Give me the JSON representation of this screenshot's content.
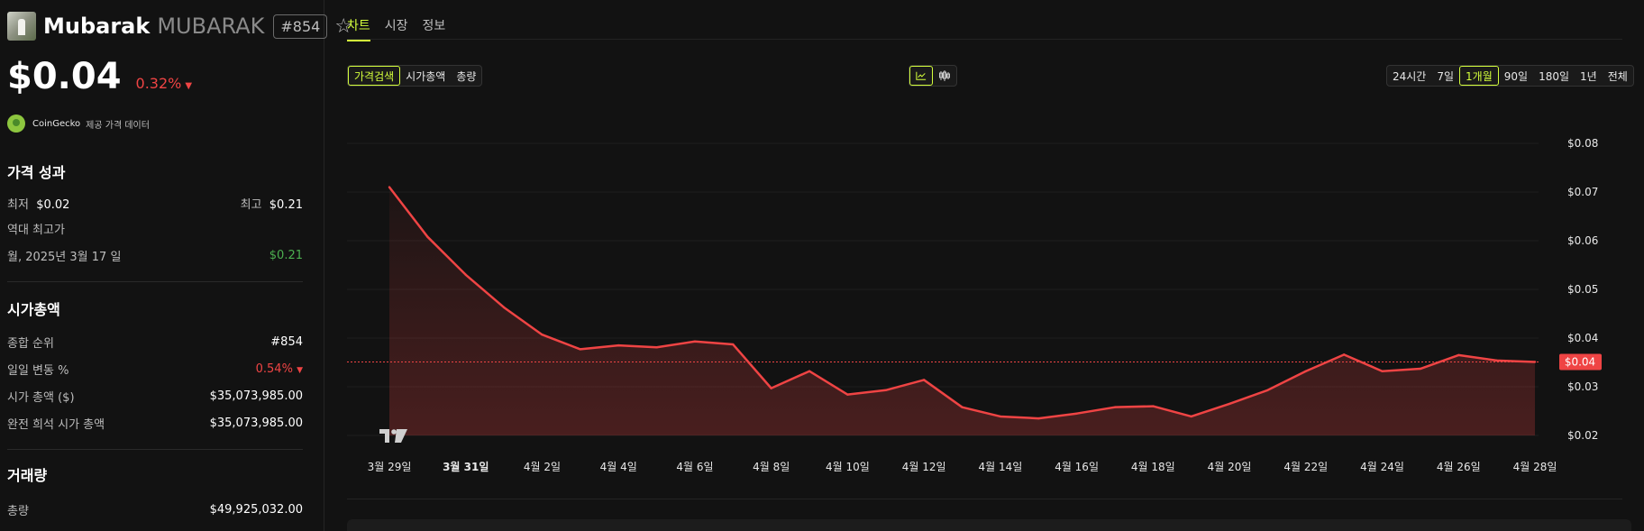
{
  "coin": {
    "name": "Mubarak",
    "symbol": "MUBARAK",
    "rank_badge": "#854",
    "price": "$0.04",
    "change": "0.32%"
  },
  "source": {
    "name": "CoinGecko",
    "note": "제공 가격 데이터"
  },
  "performance": {
    "title": "가격 성과",
    "low_label": "최저",
    "low_value": "$0.02",
    "high_label": "최고",
    "high_value": "$0.21",
    "ath_label": "역대 최고가",
    "ath_date": "월, 2025년 3월 17 일",
    "ath_value": "$0.21"
  },
  "market": {
    "title": "시가총액",
    "rows": [
      {
        "label": "종합 순위",
        "value": "#854"
      },
      {
        "label": "일일 변동 %",
        "value": "0.54%"
      },
      {
        "label": "시가 총액 ($)",
        "value": "$35,073,985.00"
      },
      {
        "label": "완전 희석 시가 총액",
        "value": "$35,073,985.00"
      }
    ]
  },
  "volume": {
    "title": "거래량",
    "label": "총량",
    "value": "$49,925,032.00"
  },
  "tabs": [
    "차트",
    "시장",
    "정보"
  ],
  "metric_buttons": [
    "가격검색",
    "시가총액",
    "총량"
  ],
  "range_buttons": [
    "24시간",
    "7일",
    "1개월",
    "90일",
    "180일",
    "1년",
    "전체"
  ],
  "colors": {
    "accent": "#d4ff3b",
    "line": "#ef4444",
    "positive": "#4caf50",
    "negative": "#ef4444"
  },
  "icons": {
    "line_chart": "line-chart-icon",
    "candle_chart": "candlestick-icon",
    "star": "star-icon",
    "tradingview": "tradingview-logo"
  },
  "chart_data": {
    "type": "area",
    "x": [
      "3월 29일",
      "3월 30일",
      "3월 31일",
      "4월 1일",
      "4월 2일",
      "4월 3일",
      "4월 4일",
      "4월 5일",
      "4월 6일",
      "4월 7일",
      "4월 8일",
      "4월 9일",
      "4월 10일",
      "4월 11일",
      "4월 12일",
      "4월 13일",
      "4월 14일",
      "4월 15일",
      "4월 16일",
      "4월 17일",
      "4월 18일",
      "4월 19일",
      "4월 20일",
      "4월 21일",
      "4월 22일",
      "4월 23일",
      "4월 24일",
      "4월 25일",
      "4월 26일",
      "4월 27일",
      "4월 28일"
    ],
    "y": [
      0.071,
      0.0608,
      0.053,
      0.0463,
      0.0407,
      0.0377,
      0.0385,
      0.0381,
      0.0393,
      0.0387,
      0.0297,
      0.0332,
      0.0284,
      0.0293,
      0.0314,
      0.0258,
      0.0239,
      0.0235,
      0.0245,
      0.0258,
      0.026,
      0.0239,
      0.0265,
      0.0293,
      0.0332,
      0.0366,
      0.0332,
      0.0337,
      0.0365,
      0.0354,
      0.0351
    ],
    "x_ticks": [
      "3월 29일",
      "3월 31일",
      "4월 2일",
      "4월 4일",
      "4월 6일",
      "4월 8일",
      "4월 10일",
      "4월 12일",
      "4월 14일",
      "4월 16일",
      "4월 18일",
      "4월 20일",
      "4월 22일",
      "4월 24일",
      "4월 26일",
      "4월 28일"
    ],
    "y_ticks": [
      "$0.08",
      "$0.07",
      "$0.06",
      "$0.05",
      "$0.04",
      "$0.03",
      "$0.02"
    ],
    "ylim": [
      0.02,
      0.08
    ],
    "current_value": 0.0351,
    "current_label": "$0.04",
    "grid": true
  }
}
